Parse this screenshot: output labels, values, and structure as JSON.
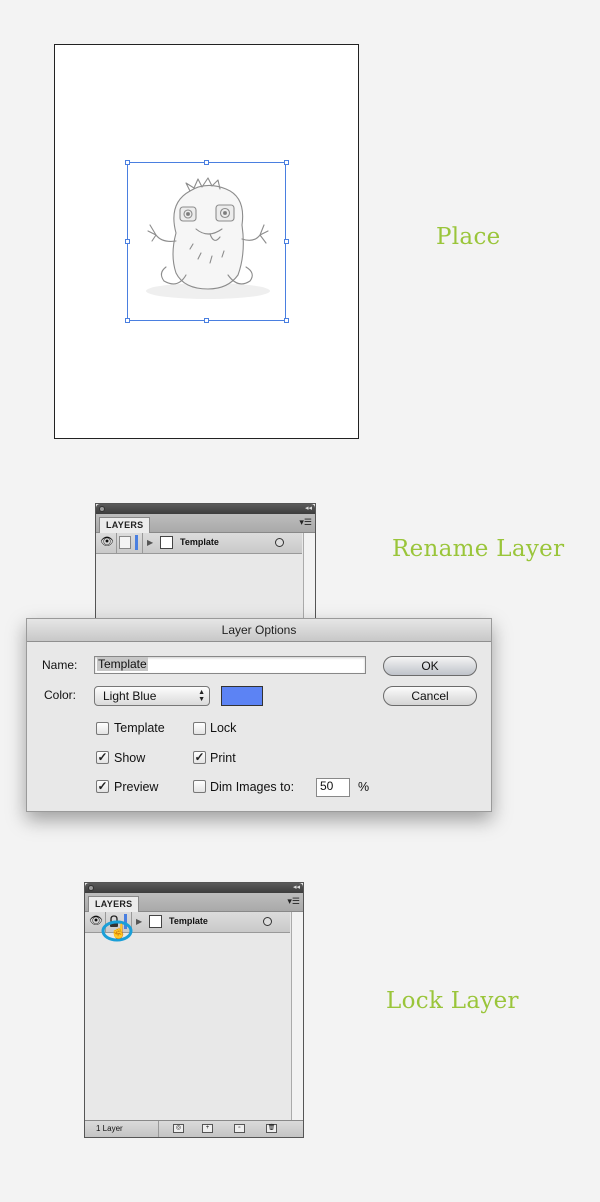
{
  "steps": {
    "place": "Place",
    "rename": "Rename Layer",
    "lock": "Lock Layer"
  },
  "layers_panel": {
    "tab_label": "LAYERS",
    "menu_icon": "panel-menu-icon",
    "layer_name": "Template",
    "footer_count": "1 Layer"
  },
  "dialog": {
    "title": "Layer Options",
    "name_label": "Name:",
    "name_value": "Template",
    "color_label": "Color:",
    "color_value": "Light Blue",
    "swatch_color": "#5c83f4",
    "ok_label": "OK",
    "cancel_label": "Cancel",
    "checkboxes": {
      "template": {
        "label": "Template",
        "checked": false
      },
      "lock": {
        "label": "Lock",
        "checked": false
      },
      "show": {
        "label": "Show",
        "checked": true
      },
      "print": {
        "label": "Print",
        "checked": true
      },
      "preview": {
        "label": "Preview",
        "checked": true
      },
      "dim": {
        "label": "Dim Images to:",
        "checked": false
      }
    },
    "dim_value": "50",
    "dim_unit": "%"
  },
  "colors": {
    "step_label": "#9ac53a",
    "selection_blue": "#4a7fe0",
    "highlight_circle": "#1a9fd8"
  }
}
